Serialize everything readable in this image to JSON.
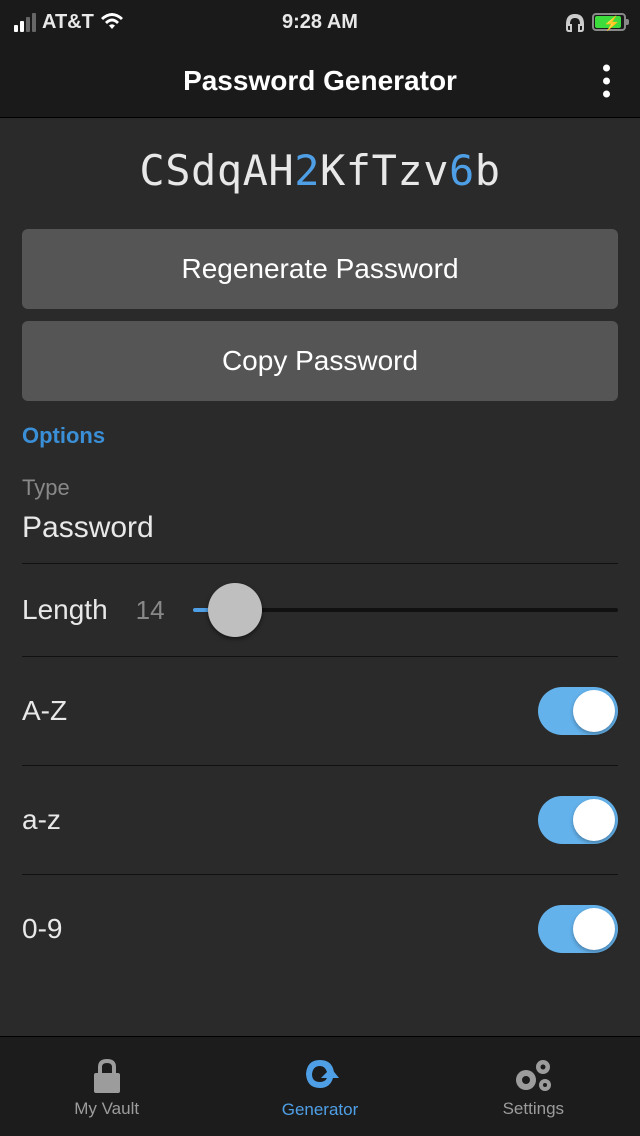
{
  "status": {
    "carrier": "AT&T",
    "time": "9:28 AM"
  },
  "header": {
    "title": "Password Generator"
  },
  "password": {
    "chars": [
      {
        "c": "C",
        "t": "char"
      },
      {
        "c": "S",
        "t": "char"
      },
      {
        "c": "d",
        "t": "char"
      },
      {
        "c": "q",
        "t": "char"
      },
      {
        "c": "A",
        "t": "char"
      },
      {
        "c": "H",
        "t": "char"
      },
      {
        "c": "2",
        "t": "digit"
      },
      {
        "c": "K",
        "t": "char"
      },
      {
        "c": "f",
        "t": "char"
      },
      {
        "c": "T",
        "t": "char"
      },
      {
        "c": "z",
        "t": "char"
      },
      {
        "c": "v",
        "t": "char"
      },
      {
        "c": "6",
        "t": "digit"
      },
      {
        "c": "b",
        "t": "char"
      }
    ]
  },
  "buttons": {
    "regenerate": "Regenerate Password",
    "copy": "Copy Password"
  },
  "options": {
    "section_label": "Options",
    "type_label": "Type",
    "type_value": "Password",
    "length_label": "Length",
    "length_value": "14",
    "toggles": {
      "upper_label": "A-Z",
      "lower_label": "a-z",
      "digits_label": "0-9"
    }
  },
  "tabs": {
    "vault": "My Vault",
    "generator": "Generator",
    "settings": "Settings"
  }
}
